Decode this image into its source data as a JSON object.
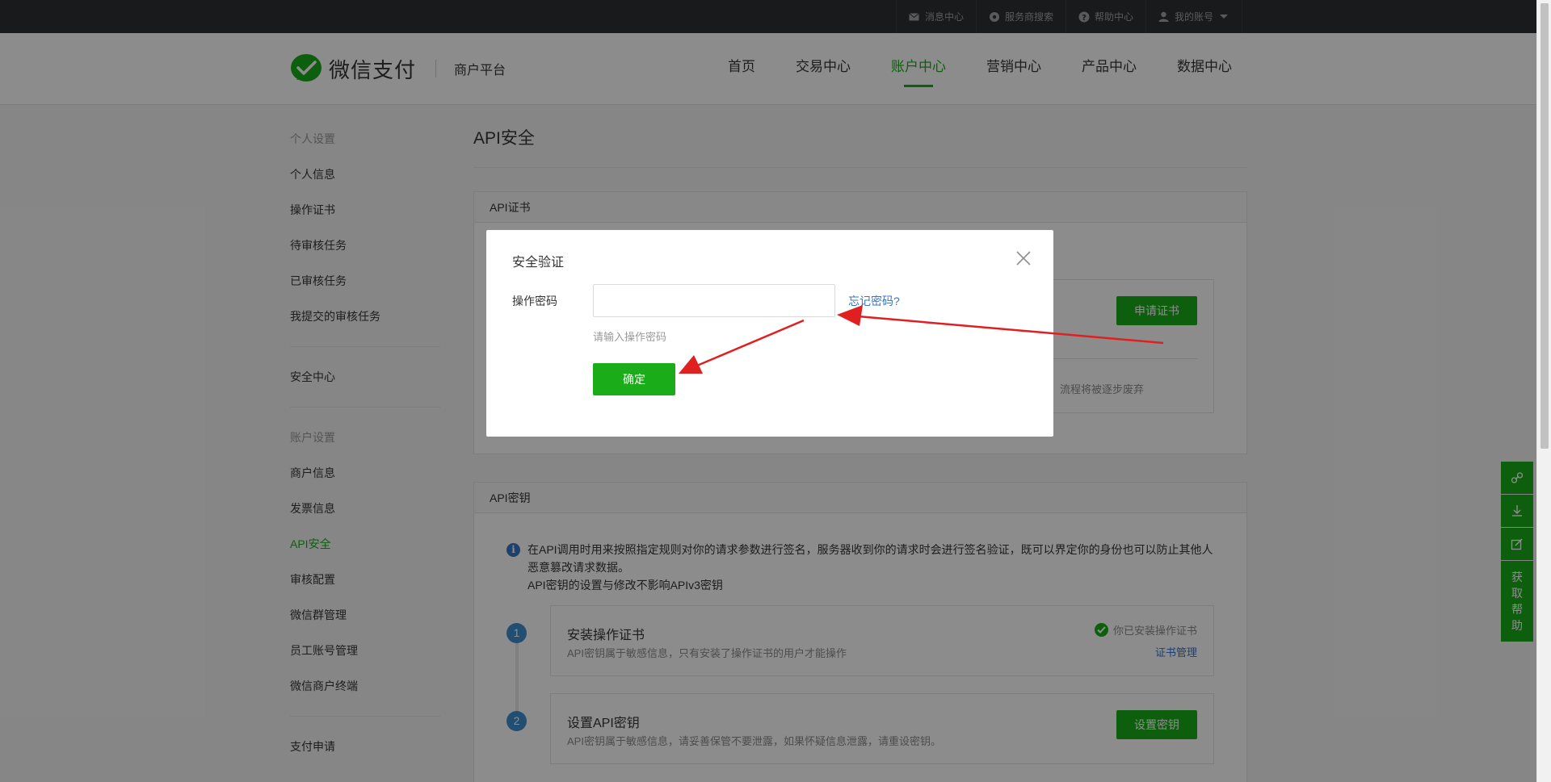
{
  "topbar": {
    "items": [
      {
        "label": "消息中心",
        "icon": "mail-icon"
      },
      {
        "label": "服务商搜索",
        "icon": "gear-icon"
      },
      {
        "label": "帮助中心",
        "icon": "help-icon"
      },
      {
        "label": "我的账号",
        "icon": "user-icon"
      }
    ]
  },
  "header": {
    "brand": "微信支付",
    "platform": "商户平台",
    "nav": [
      {
        "label": "首页"
      },
      {
        "label": "交易中心"
      },
      {
        "label": "账户中心",
        "active": true
      },
      {
        "label": "营销中心"
      },
      {
        "label": "产品中心"
      },
      {
        "label": "数据中心"
      }
    ]
  },
  "sidebar": {
    "group1": "个人设置",
    "items1": [
      "个人信息",
      "操作证书",
      "待审核任务",
      "已审核任务",
      "我提交的审核任务"
    ],
    "security": "安全中心",
    "group2": "账户设置",
    "items2": [
      "商户信息",
      "发票信息",
      "API安全",
      "审核配置",
      "微信群管理",
      "员工账号管理",
      "微信商户终端"
    ],
    "active": "API安全",
    "apply": "支付申请"
  },
  "content": {
    "title": "API安全",
    "cert_panel": {
      "header": "API证书",
      "apply_button": "申请证书",
      "note": "流程将被逐步废弃"
    },
    "key_panel": {
      "header": "API密钥",
      "info_line1": "在API调用时用来按照指定规则对你的请求参数进行签名，服务器收到你的请求时会进行签名验证，既可以界定你的身份也可以防止其他人",
      "info_line2": "恶意篡改请求数据。",
      "info_line3": "API密钥的设置与修改不影响APIv3密钥",
      "step1": {
        "no": "1",
        "title": "安装操作证书",
        "desc": "API密钥属于敏感信息，只有安装了操作证书的用户才能操作",
        "status": "你已安装操作证书",
        "link": "证书管理"
      },
      "step2": {
        "no": "2",
        "title": "设置API密钥",
        "desc": "API密钥属于敏感信息，请妥善保管不要泄露，如果怀疑信息泄露，请重设密钥。",
        "button": "设置密钥"
      }
    }
  },
  "float_bar": {
    "icons": [
      "link-icon",
      "download-icon",
      "edit-icon"
    ],
    "help": [
      "获",
      "取",
      "帮",
      "助"
    ]
  },
  "modal": {
    "title": "安全验证",
    "label": "操作密码",
    "value": "",
    "forgot": "忘记密码?",
    "hint": "请输入操作密码",
    "confirm": "确定"
  },
  "colors": {
    "brand_green": "#1aad19",
    "link_blue": "#3775c8",
    "arrow_red": "#e02020",
    "topbar": "#2e3034"
  }
}
